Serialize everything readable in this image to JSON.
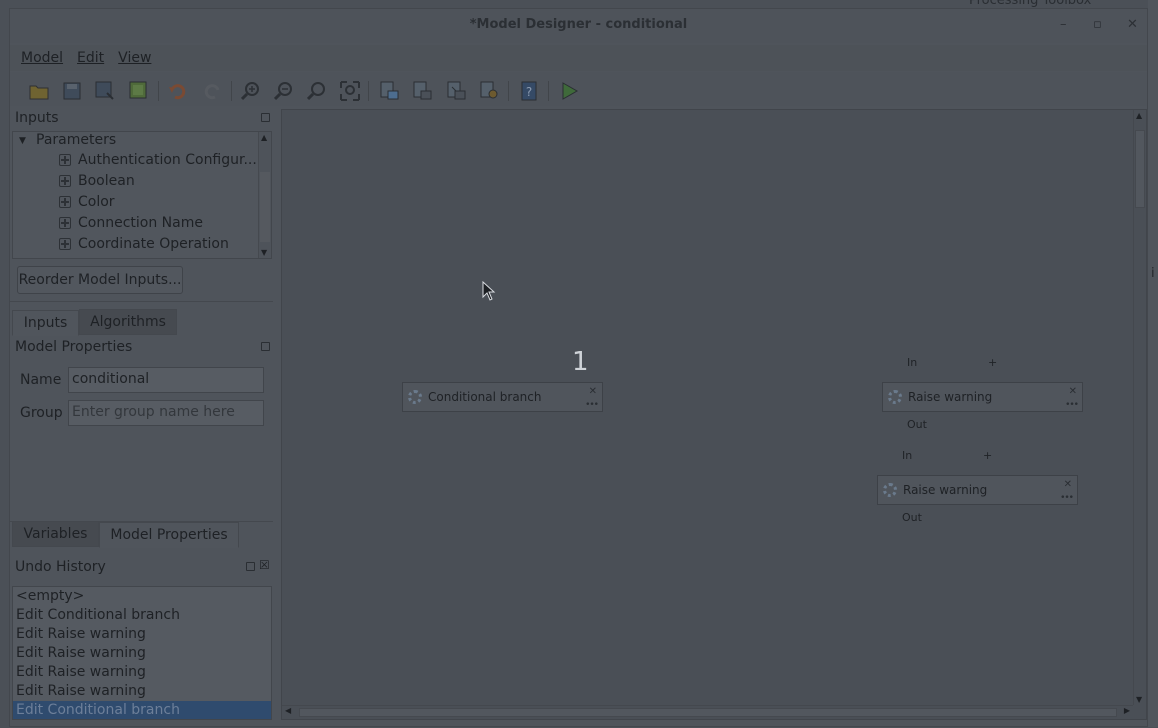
{
  "background_app": {
    "panel_title": "Processing Toolbox",
    "edge_char": "i"
  },
  "window": {
    "title": "*Model Designer - conditional",
    "controls": {
      "minimize": "–",
      "maximize": "▫",
      "close": "✕"
    }
  },
  "menubar": {
    "items": [
      "Model",
      "Edit",
      "View"
    ]
  },
  "toolbar": {
    "buttons": [
      "open-model-icon",
      "save-model-icon",
      "save-as-icon",
      "save-to-project-icon",
      "undo-icon",
      "redo-icon",
      "zoom-in-icon",
      "zoom-out-icon",
      "zoom-actual-icon",
      "zoom-full-icon",
      "export-image-icon",
      "export-pdf-icon",
      "export-svg-icon",
      "export-python-icon",
      "edit-help-icon",
      "run-model-icon"
    ]
  },
  "inputs_panel": {
    "title": "Inputs",
    "group_label": "Parameters",
    "items": [
      "Authentication Configur...",
      "Boolean",
      "Color",
      "Connection Name",
      "Coordinate Operation"
    ],
    "reorder_button": "Reorder Model Inputs...",
    "tabs": [
      "Inputs",
      "Algorithms"
    ]
  },
  "model_properties": {
    "title": "Model Properties",
    "name_label": "Name",
    "name_value": "conditional",
    "group_label": "Group",
    "group_placeholder": "Enter group name here",
    "tabs": [
      "Variables",
      "Model Properties"
    ]
  },
  "undo_history": {
    "title": "Undo History",
    "items": [
      "<empty>",
      "Edit Conditional branch",
      "Edit Raise warning",
      "Edit Raise warning",
      "Edit Raise warning",
      "Edit Raise warning",
      "Edit Conditional branch"
    ],
    "selected_index": 6
  },
  "canvas": {
    "badge": "1",
    "nodes": [
      {
        "label": "Conditional branch"
      },
      {
        "label": "Raise warning",
        "in": "In",
        "plus": "+",
        "out": "Out"
      },
      {
        "label": "Raise warning",
        "in": "In",
        "plus": "+",
        "out": "Out"
      }
    ]
  },
  "colors": {
    "selection": "#2f4b6e",
    "overlay_dim": "#4b5057"
  }
}
